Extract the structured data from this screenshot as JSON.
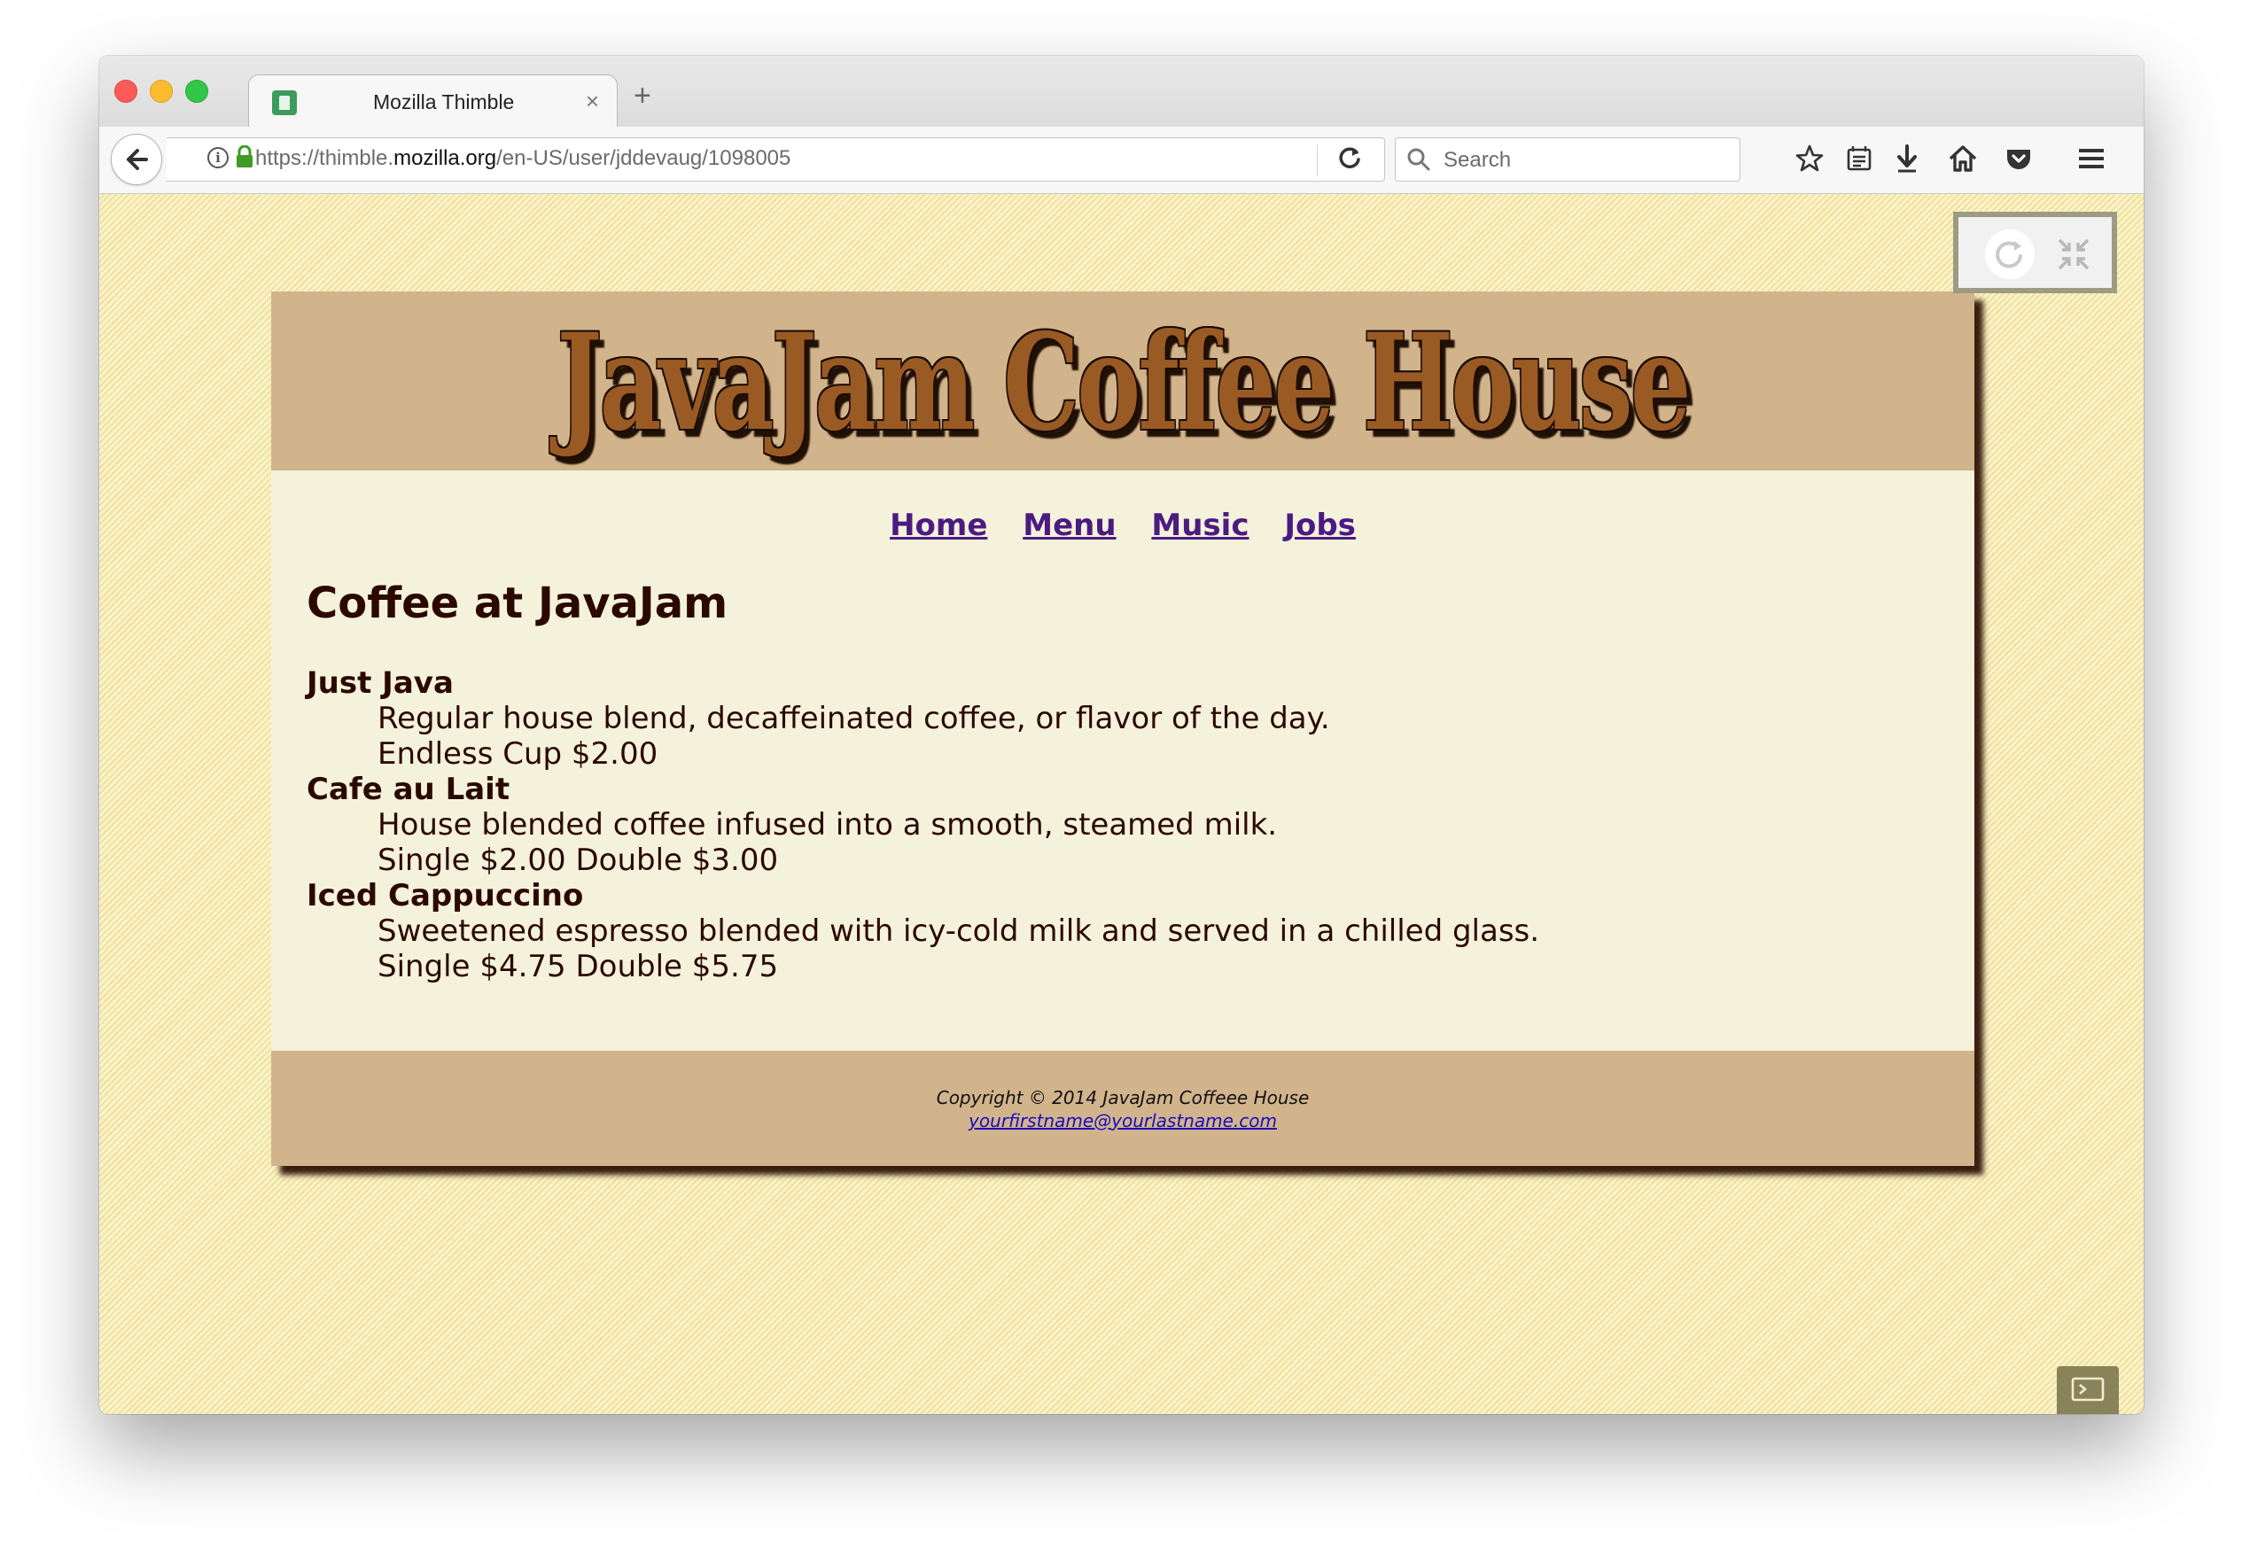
{
  "browser": {
    "tab": {
      "title": "Mozilla Thimble",
      "close_glyph": "×"
    },
    "new_tab_glyph": "+",
    "url": {
      "prefix": "https://thimble.",
      "domain": "mozilla.org",
      "path": "/en-US/user/jddevaug/1098005"
    },
    "search_placeholder": "Search",
    "toolbar_icons": [
      "bookmark-star-icon",
      "reading-list-icon",
      "download-icon",
      "home-icon",
      "pocket-icon",
      "hamburger-menu-icon"
    ]
  },
  "site": {
    "logo": "JavaJam Coffee House",
    "nav": [
      {
        "label": "Home"
      },
      {
        "label": "Menu"
      },
      {
        "label": "Music"
      },
      {
        "label": "Jobs"
      }
    ],
    "heading": "Coffee at JavaJam",
    "menu_items": [
      {
        "name": "Just Java",
        "description": "Regular house blend, decaffeinated coffee, or flavor of the day.",
        "price": "Endless Cup $2.00"
      },
      {
        "name": "Cafe au Lait",
        "description": "House blended coffee infused into a smooth, steamed milk.",
        "price": "Single $2.00 Double $3.00"
      },
      {
        "name": "Iced Cappuccino",
        "description": "Sweetened espresso blended with icy-cold milk and served in a chilled glass.",
        "price": "Single $4.75 Double $5.75"
      }
    ],
    "footer": {
      "copyright": "Copyright © 2014 JavaJam Coffeee House",
      "email": "yourfirstname@yourlastname.com"
    }
  },
  "colors": {
    "header_bg": "#d2b48c",
    "page_bg": "#f5f2dc",
    "text": "#2b0900",
    "nav_link": "#4b1b82",
    "backdrop": "#f3e8a6"
  }
}
